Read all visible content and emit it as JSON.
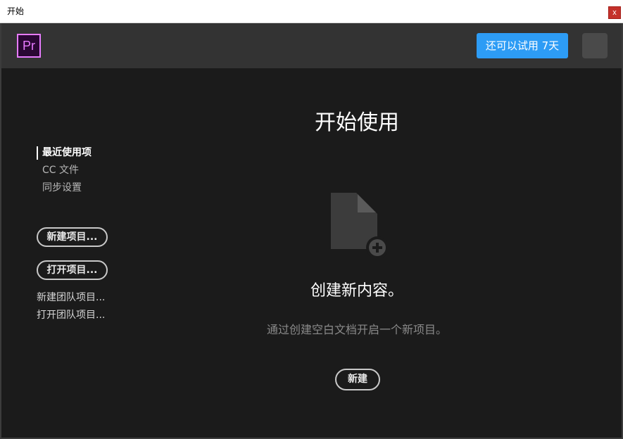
{
  "window": {
    "title": "开始",
    "close_label": "x"
  },
  "header": {
    "logo_text": "Pr",
    "trial_label": "还可以试用 7天",
    "colors": {
      "brand": "#e77bff",
      "accent": "#2d9cf5"
    }
  },
  "sidebar": {
    "nav": [
      {
        "label": "最近使用项",
        "active": true
      },
      {
        "label": "CC 文件",
        "active": false
      },
      {
        "label": "同步设置",
        "active": false
      }
    ],
    "new_project_label": "新建项目...",
    "open_project_label": "打开项目...",
    "new_team_project_label": "新建团队项目...",
    "open_team_project_label": "打开团队项目..."
  },
  "main": {
    "heading": "开始使用",
    "icon": "new-document-icon",
    "create_title": "创建新内容。",
    "create_desc": "通过创建空白文档开启一个新项目。",
    "new_label": "新建"
  }
}
